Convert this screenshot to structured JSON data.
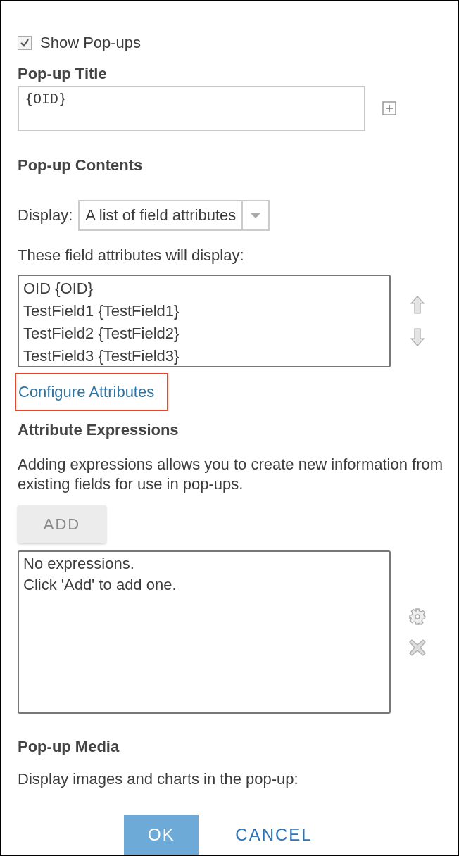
{
  "show_popups": {
    "label": "Show Pop-ups",
    "checked": true
  },
  "popup_title": {
    "heading": "Pop-up Title",
    "value": "{OID}"
  },
  "popup_contents": {
    "heading": "Pop-up Contents",
    "display_label": "Display:",
    "display_value": "A list of field attributes",
    "fields_label": "These field attributes will display:",
    "fields": [
      "OID {OID}",
      "TestField1 {TestField1}",
      "TestField2 {TestField2}",
      "TestField3 {TestField3}"
    ],
    "configure_link": {
      "label": "Configure Attributes",
      "highlighted": true
    }
  },
  "attribute_expressions": {
    "heading": "Attribute Expressions",
    "description": "Adding expressions allows you to create new information from existing fields for use in pop-ups.",
    "add_button": "ADD",
    "empty_lines": [
      "No expressions.",
      "Click 'Add' to add one."
    ]
  },
  "popup_media": {
    "heading": "Pop-up Media",
    "description": "Display images and charts in the pop-up:"
  },
  "buttons": [
    {
      "label": "OK",
      "kind": "primary"
    },
    {
      "label": "CANCEL",
      "kind": "secondary"
    }
  ]
}
